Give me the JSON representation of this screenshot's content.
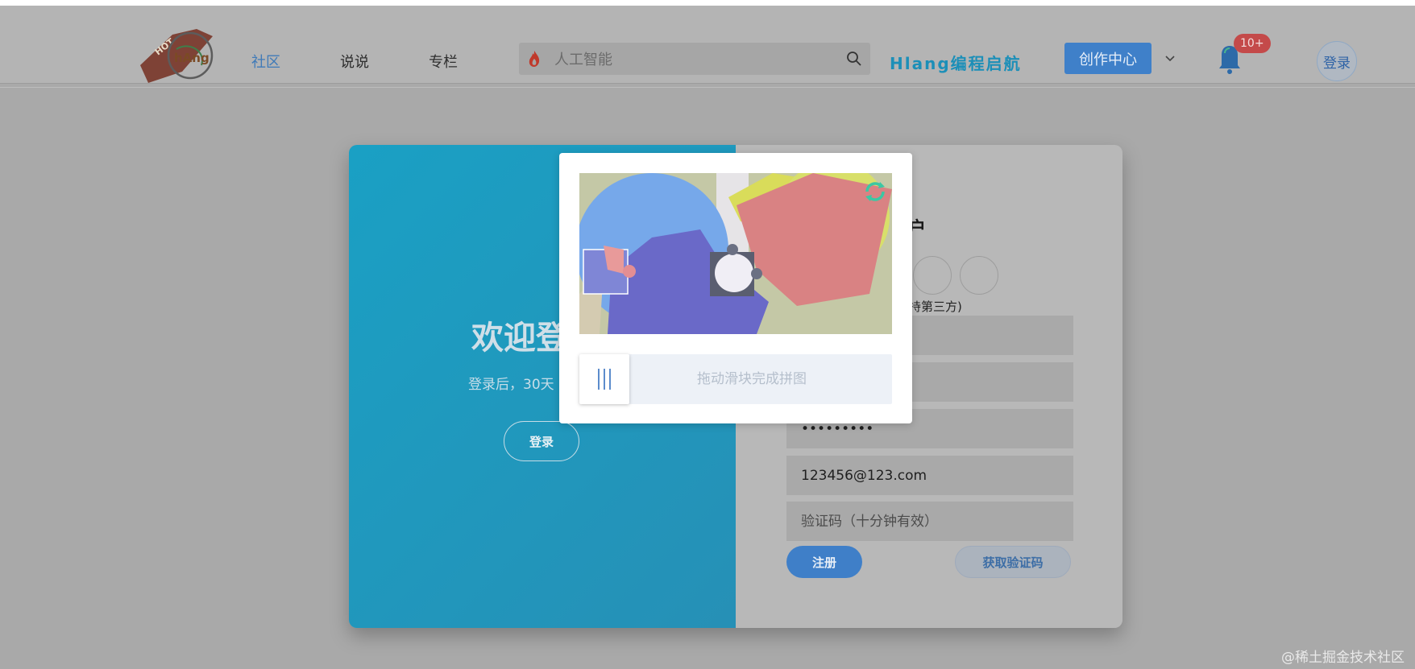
{
  "header": {
    "nav": [
      "社区",
      "说说",
      "专栏"
    ],
    "search_placeholder": "人工智能",
    "brand": "Hlang编程启航",
    "create_button": "创作中心",
    "notification_badge": "10+",
    "login_circle": "登录"
  },
  "card": {
    "left": {
      "welcome": "欢迎登",
      "subtext": "登录后，30天",
      "login_button": "登录"
    },
    "right": {
      "title_partial": "建账户",
      "hint_partial": "暂不支持第三方)",
      "password_value": "•••••••••",
      "email_value": "123456@123.com",
      "code_placeholder": "验证码（十分钟有效）",
      "register_button": "注册",
      "get_code_button": "获取验证码"
    }
  },
  "captcha": {
    "slider_text": "拖动滑块完成拼图"
  },
  "watermark": "@稀土掘金技术社区",
  "colors": {
    "accent": "#3f80c9",
    "card_gradient_start": "#1aa0c4",
    "brand": "#1c8fb8",
    "badge": "#c44a4a"
  }
}
